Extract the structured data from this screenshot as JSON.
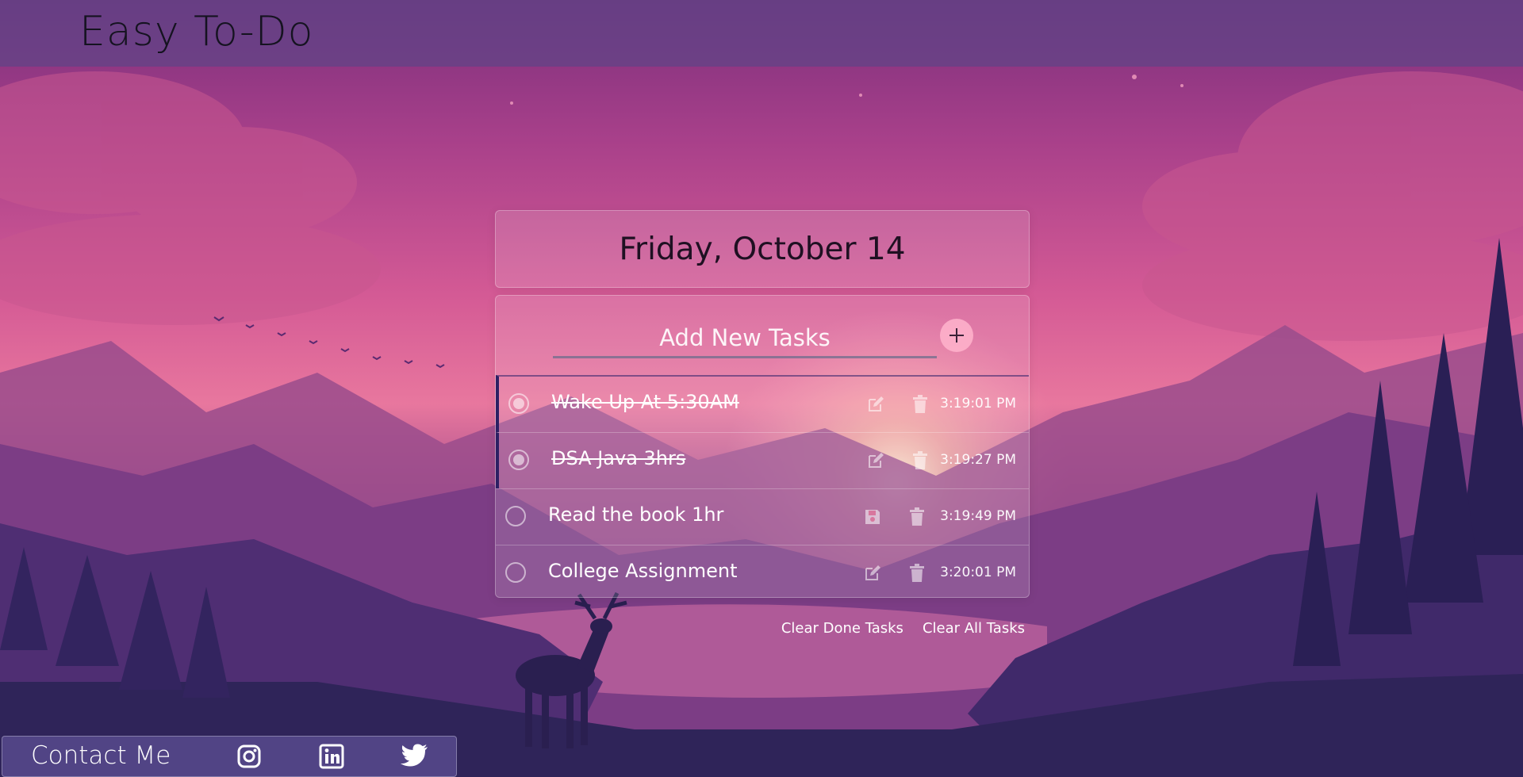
{
  "app": {
    "title": "Easy To-Do"
  },
  "date_card": {
    "date": "Friday, October 14"
  },
  "add_task": {
    "placeholder": "Add New Tasks",
    "button_icon": "plus-icon"
  },
  "tasks": [
    {
      "text": "Wake Up At 5:30AM",
      "time": "3:19:01 PM",
      "done": true,
      "action_icon": "edit-icon"
    },
    {
      "text": "DSA Java 3hrs",
      "time": "3:19:27 PM",
      "done": true,
      "action_icon": "edit-icon"
    },
    {
      "text": "Read the book 1hr",
      "time": "3:19:49 PM",
      "done": false,
      "action_icon": "save-icon"
    },
    {
      "text": "College Assignment",
      "time": "3:20:01 PM",
      "done": false,
      "action_icon": "edit-icon"
    }
  ],
  "actions": {
    "clear_done": "Clear Done Tasks",
    "clear_all": "Clear All Tasks"
  },
  "footer": {
    "label": "Contact Me",
    "social_icons": [
      "instagram-icon",
      "linkedin-icon",
      "twitter-icon"
    ]
  },
  "colors": {
    "topbar": "#5f4487",
    "accent_dark": "#2d2064",
    "plus_button": "#ffb4cd"
  }
}
